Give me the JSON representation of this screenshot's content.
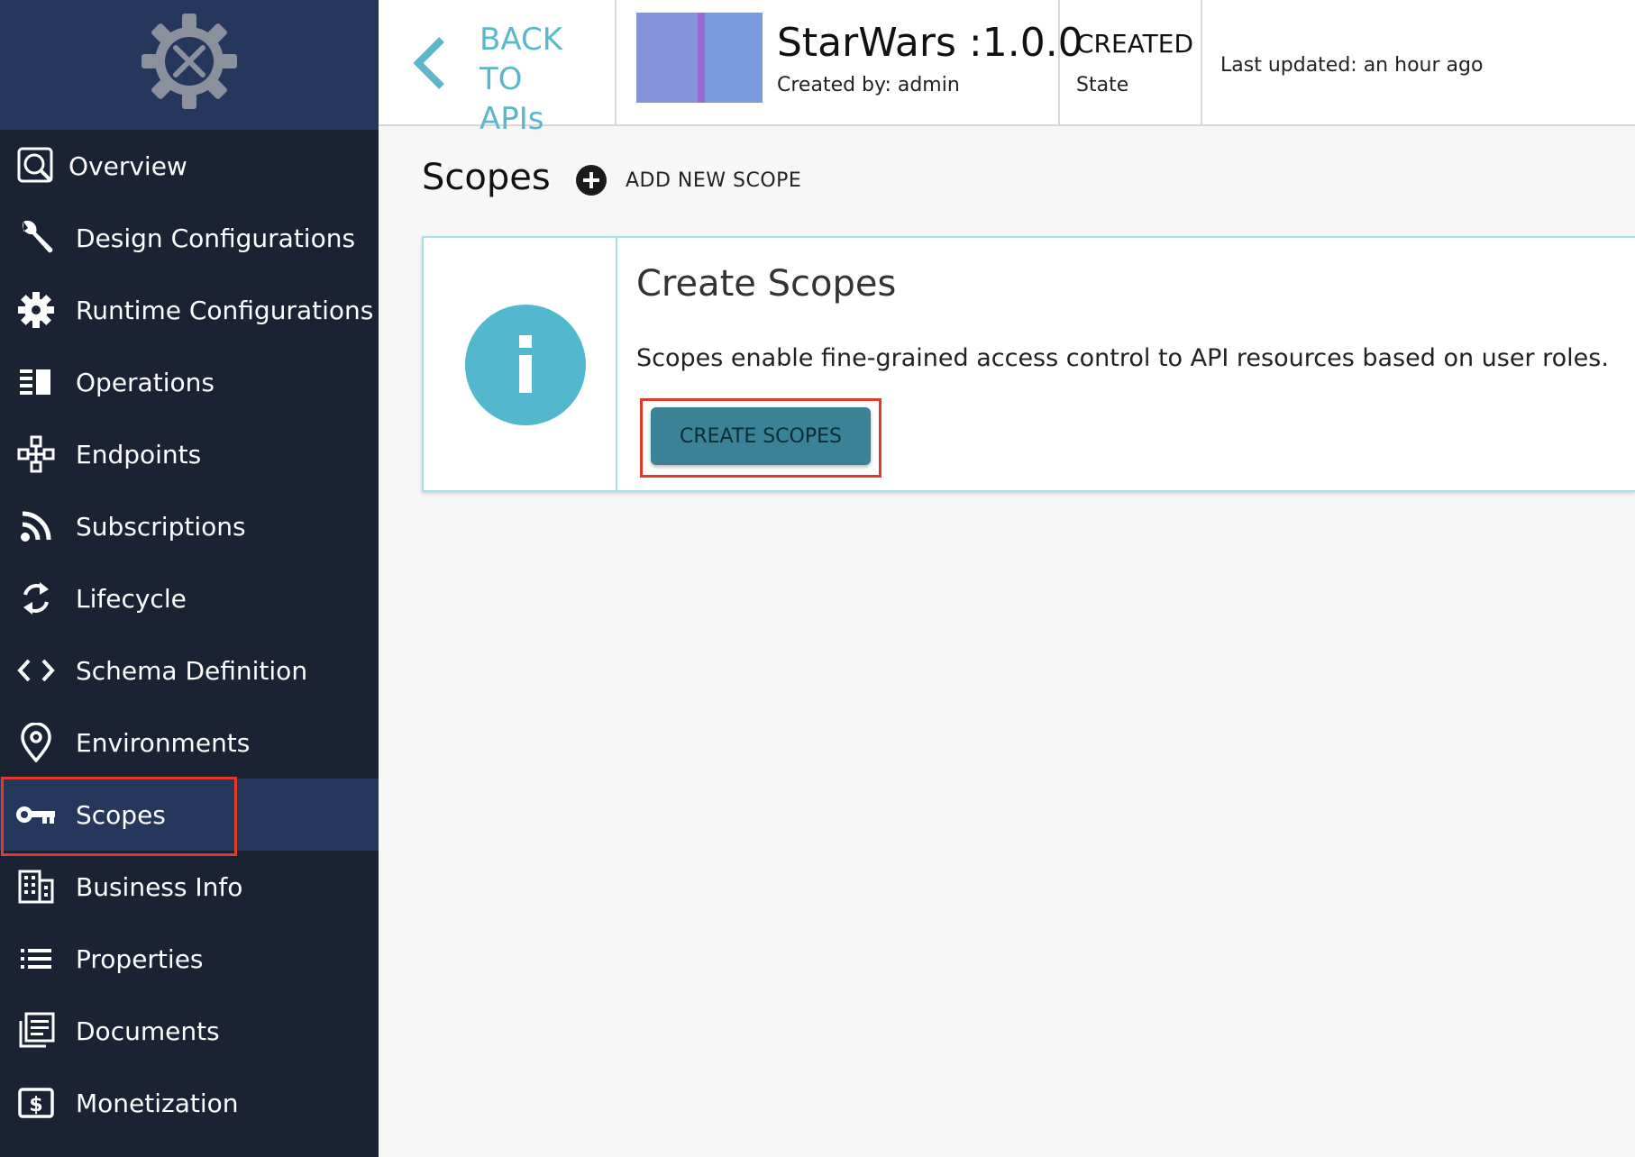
{
  "app": {
    "logo_icon": "gear-tools-icon"
  },
  "sidebar": {
    "items": [
      {
        "label": "Overview",
        "icon": "overview-icon"
      },
      {
        "label": "Design Configurations",
        "icon": "wrench-icon"
      },
      {
        "label": "Runtime Configurations",
        "icon": "gear-icon"
      },
      {
        "label": "Operations",
        "icon": "operations-icon"
      },
      {
        "label": "Endpoints",
        "icon": "endpoints-icon"
      },
      {
        "label": "Subscriptions",
        "icon": "rss-icon"
      },
      {
        "label": "Lifecycle",
        "icon": "refresh-icon"
      },
      {
        "label": "Schema Definition",
        "icon": "code-icon"
      },
      {
        "label": "Environments",
        "icon": "location-pin-icon"
      },
      {
        "label": "Scopes",
        "icon": "key-icon",
        "active": true
      },
      {
        "label": "Business Info",
        "icon": "building-icon"
      },
      {
        "label": "Properties",
        "icon": "list-icon"
      },
      {
        "label": "Documents",
        "icon": "documents-icon"
      },
      {
        "label": "Monetization",
        "icon": "dollar-icon"
      }
    ],
    "background": "#1b2233",
    "active_background": "#25375a"
  },
  "header": {
    "back_line1": "BACK TO",
    "back_line2": "APIs",
    "api_name": "StarWars :1.0.0",
    "created_by": "Created by: admin",
    "state_value": "CREATED",
    "state_label": "State",
    "last_updated": "Last updated: an hour ago",
    "accent": "#5bb7cc"
  },
  "main": {
    "title": "Scopes",
    "add_label": "ADD NEW SCOPE",
    "card": {
      "title": "Create Scopes",
      "description": "Scopes enable fine-grained access control to API resources based on user roles.",
      "button_label": "CREATE SCOPES",
      "icon": "info-icon",
      "icon_color": "#53b8ce",
      "button_color": "#3a8396"
    }
  },
  "highlight_color": "#e23a2a"
}
